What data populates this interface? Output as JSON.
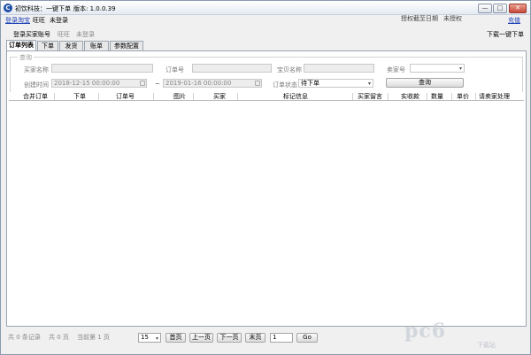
{
  "window": {
    "title": "初饮科技：一键下单",
    "version": "版本: 1.0.0.39",
    "btn_min": "—",
    "btn_max": "□",
    "btn_close": "✕"
  },
  "topbar": {
    "login_taobao": "登录淘宝",
    "wangwang_label": "旺旺",
    "wangwang_status": "未登录",
    "auth_expiry_label": "授权截至日期",
    "auth_status": "未授权",
    "recharge": "充值"
  },
  "row2": {
    "login_buyer": "登录买家账号",
    "wangwang_label": "旺旺",
    "wangwang_status": "未登录",
    "download_one_click": "下载一键下单"
  },
  "tabs": [
    "订单列表",
    "下单",
    "发货",
    "账单",
    "参数配置"
  ],
  "query": {
    "group_title": "查询",
    "buyer_name_label": "买家名称",
    "order_no_label": "订单号",
    "product_name_label": "宝贝名称",
    "seller_no_label": "卖家号",
    "created_time_label": "创建时间",
    "start_time": "2018-12-15 00:00:00",
    "end_time": "2019-01-16 00:00:00",
    "range_sep": "~",
    "order_status_label": "订单状态",
    "order_status_value": "待下单",
    "query_button": "查询"
  },
  "table": {
    "columns": [
      "合并订单",
      "下单",
      "订单号",
      "图片",
      "买家",
      "标记信息",
      "买家留言",
      "实收款",
      "数量",
      "单价",
      "请卖家处理"
    ],
    "rows": []
  },
  "pager": {
    "total_records": "共 0 条记录",
    "total_pages": "共 0 页",
    "current_page": "当前第 1 页",
    "page_size": "15",
    "first": "首页",
    "prev": "上一页",
    "next": "下一页",
    "last": "末页",
    "page_input": "1",
    "go": "Go"
  },
  "watermark": {
    "brand": "pc6",
    "sub": "下载站"
  }
}
